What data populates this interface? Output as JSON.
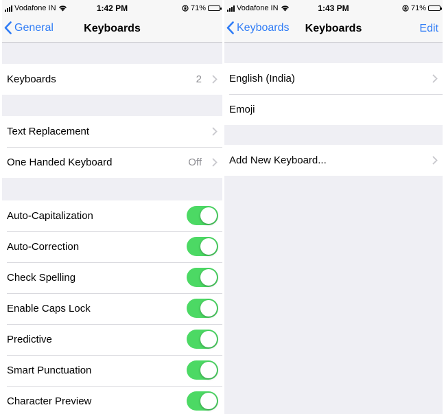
{
  "left": {
    "status": {
      "carrier": "Vodafone IN",
      "time": "1:42 PM",
      "battery": "71%",
      "battery_level": 0.71
    },
    "nav": {
      "back_label": "General",
      "title": "Keyboards"
    },
    "group1": [
      {
        "label": "Keyboards",
        "value": "2"
      }
    ],
    "group2": [
      {
        "label": "Text Replacement",
        "value": ""
      },
      {
        "label": "One Handed Keyboard",
        "value": "Off"
      }
    ],
    "toggles": [
      {
        "label": "Auto-Capitalization",
        "on": true
      },
      {
        "label": "Auto-Correction",
        "on": true
      },
      {
        "label": "Check Spelling",
        "on": true
      },
      {
        "label": "Enable Caps Lock",
        "on": true
      },
      {
        "label": "Predictive",
        "on": true
      },
      {
        "label": "Smart Punctuation",
        "on": true
      },
      {
        "label": "Character Preview",
        "on": true
      }
    ]
  },
  "right": {
    "status": {
      "carrier": "Vodafone IN",
      "time": "1:43 PM",
      "battery": "71%",
      "battery_level": 0.71
    },
    "nav": {
      "back_label": "Keyboards",
      "title": "Keyboards",
      "edit_label": "Edit"
    },
    "keyboards": [
      {
        "label": "English (India)",
        "chevron": true
      },
      {
        "label": "Emoji",
        "chevron": false
      }
    ],
    "add": {
      "label": "Add New Keyboard..."
    }
  },
  "colors": {
    "accent": "#2f7cf6",
    "toggle_on": "#4cd964",
    "background": "#efeff4"
  },
  "icons": [
    "signal-icon",
    "wifi-icon",
    "orientation-lock-icon",
    "battery-icon",
    "chevron-left-icon",
    "chevron-right-icon"
  ]
}
